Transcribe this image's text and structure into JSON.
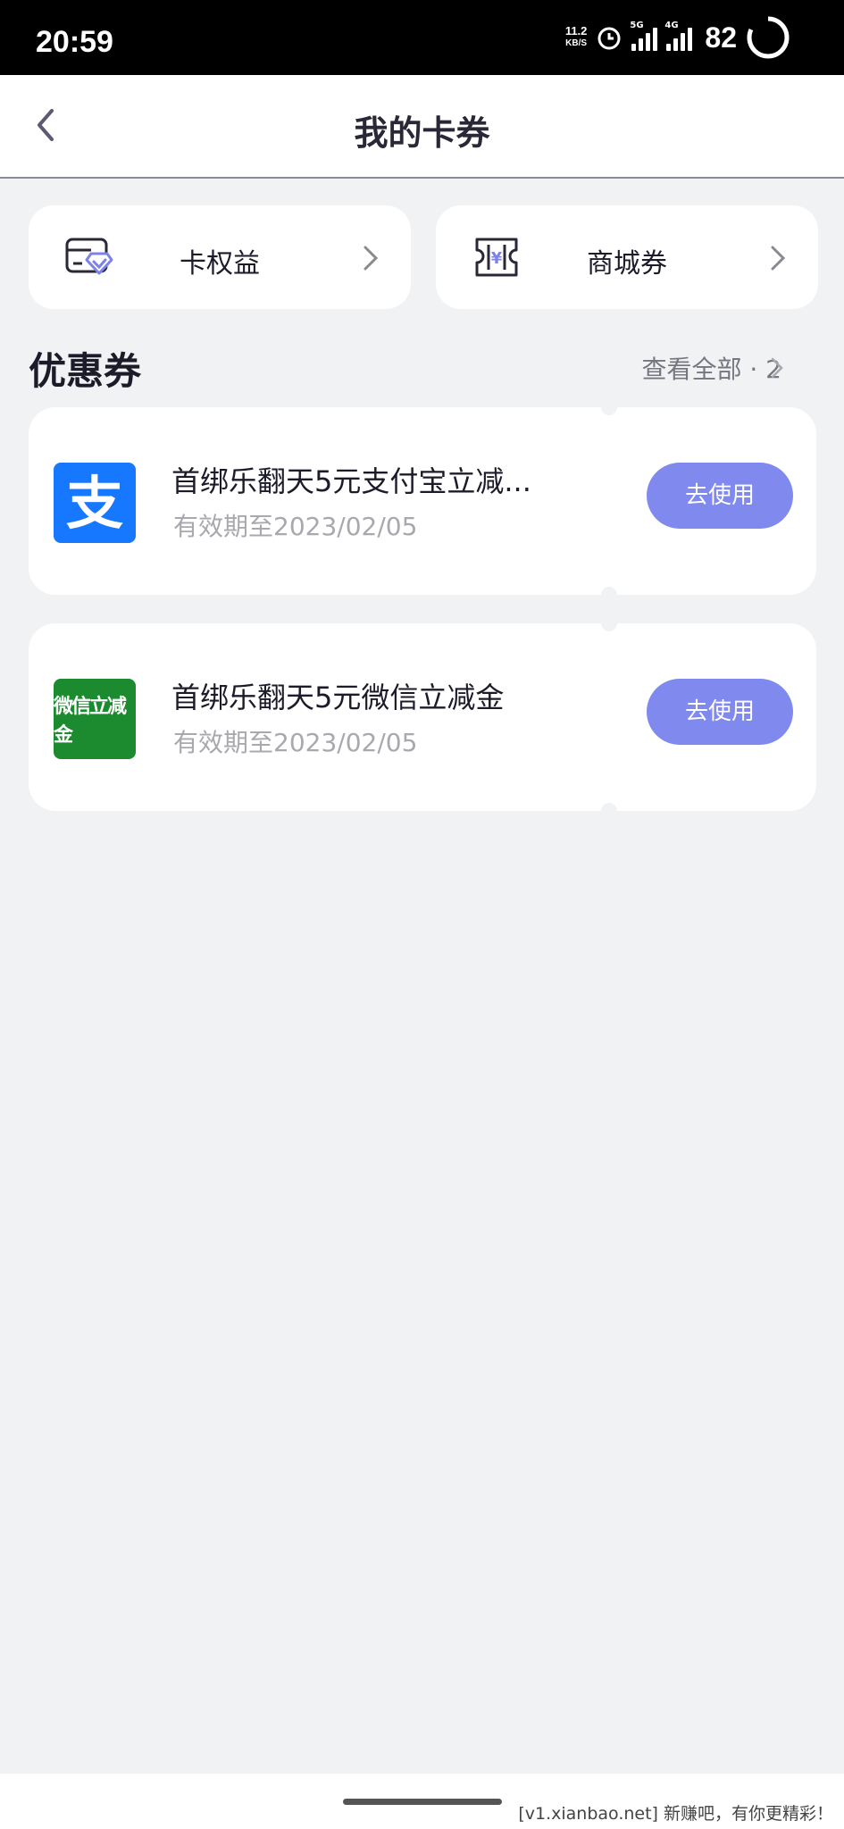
{
  "status_bar": {
    "time": "20:59",
    "net_speed_value": "11.2",
    "net_speed_unit": "KB/S",
    "sim1_tag": "5G",
    "sim2_tag": "4G",
    "battery": "82"
  },
  "header": {
    "title": "我的卡券"
  },
  "entries": [
    {
      "label": "卡权益",
      "icon": "card-benefits-icon"
    },
    {
      "label": "商城券",
      "icon": "mall-coupon-icon"
    }
  ],
  "coupons_section": {
    "title": "优惠券",
    "view_all": "查看全部 · 2"
  },
  "coupons": [
    {
      "title": "首绑乐翻天5元支付宝立减...",
      "expiry": "有效期至2023/02/05",
      "button": "去使用",
      "logo": "alipay-logo"
    },
    {
      "title": "首绑乐翻天5元微信立减金",
      "expiry": "有效期至2023/02/05",
      "button": "去使用",
      "logo": "wechat-logo",
      "logo_text": "微信立减金"
    }
  ],
  "watermark": "[v1.xianbao.net] 新赚吧，有你更精彩！",
  "colors": {
    "accent_button": "#8089ee",
    "alipay_blue": "#1677ff",
    "wechat_green": "#1c8a2e",
    "page_bg": "#f1f2f4"
  }
}
